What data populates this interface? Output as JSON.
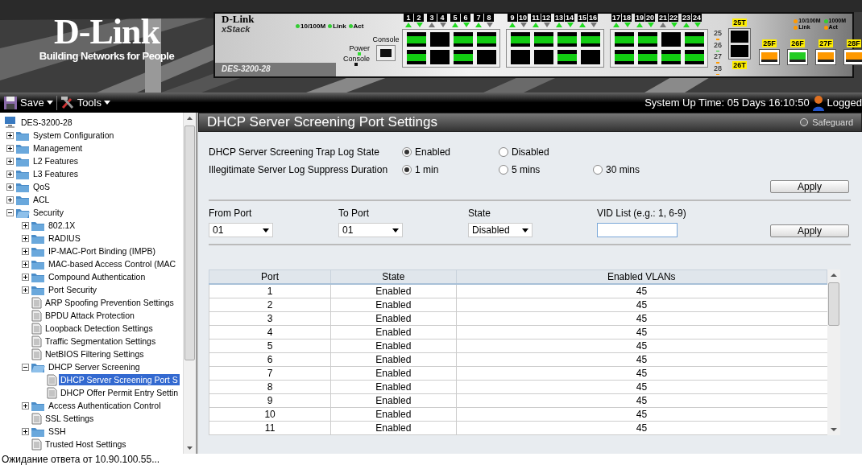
{
  "banner": {
    "logo": "D-Link",
    "tagline": "Building Networks for People",
    "device": {
      "brand": "D-Link",
      "series": "xStack",
      "model": "DES-3200-28",
      "legend": [
        {
          "label": "10/100M",
          "color": "#33cc33"
        },
        {
          "label": "Link",
          "color": "#33cc33"
        },
        {
          "label": "Act",
          "color": "#33cc33"
        }
      ],
      "leds": [
        {
          "label": "Power",
          "color": "#33dd33"
        },
        {
          "label": "Console",
          "color": "#111111"
        }
      ],
      "console_label": "Console",
      "port_groups": [
        {
          "ports": [
            {
              "number": "1",
              "link": true
            },
            {
              "number": "2",
              "link": true
            },
            {
              "number": "3",
              "link": false
            },
            {
              "number": "4",
              "link": false
            },
            {
              "number": "5",
              "link": true
            },
            {
              "number": "6",
              "link": true
            },
            {
              "number": "7",
              "link": true
            },
            {
              "number": "8",
              "link": false
            }
          ]
        },
        {
          "ports": [
            {
              "number": "9",
              "link": true
            },
            {
              "number": "10",
              "link": false
            },
            {
              "number": "11",
              "link": true
            },
            {
              "number": "12",
              "link": false
            },
            {
              "number": "13",
              "link": true
            },
            {
              "number": "14",
              "link": true
            },
            {
              "number": "15",
              "link": true
            },
            {
              "number": "16",
              "link": false
            }
          ]
        },
        {
          "ports": [
            {
              "number": "17",
              "link": true
            },
            {
              "number": "18",
              "link": true
            },
            {
              "number": "19",
              "link": true
            },
            {
              "number": "20",
              "link": true
            },
            {
              "number": "21",
              "link": false
            },
            {
              "number": "22",
              "link": true
            },
            {
              "number": "23",
              "link": true
            },
            {
              "number": "24",
              "link": true
            }
          ]
        }
      ],
      "uplink_leds": [
        {
          "label": "25",
          "color": "#ff9900"
        },
        {
          "label": "26",
          "color": "#22cc22"
        },
        {
          "label": "27",
          "color": "#ff9900"
        },
        {
          "label": "28",
          "color": "#ff9900"
        }
      ],
      "combo": {
        "top": "25T",
        "bottom": "26T"
      },
      "sfp": [
        {
          "label": "25F",
          "color": "#ff9900"
        },
        {
          "label": "26F",
          "color": "#22cc22"
        },
        {
          "label": "27F",
          "color": "#ff9900"
        },
        {
          "label": "28F",
          "color": "#ff9900"
        }
      ],
      "legend_right": [
        {
          "label": "10/100M",
          "color": "#ff9900"
        },
        {
          "label": "1000M",
          "color": "#33cc33"
        },
        {
          "label": "Link",
          "color": "#ff9900"
        },
        {
          "label": "Act",
          "color": "#ff9900"
        }
      ]
    }
  },
  "toolbar": {
    "menus": [
      "Save",
      "Tools"
    ],
    "uptime": "System Up Time: 05 Days 16:10:50",
    "user": "Logged"
  },
  "tree": {
    "label": "DES-3200-28",
    "children": [
      {
        "label": "System Configuration",
        "kind": "folder",
        "expanded": false,
        "selected": false
      },
      {
        "label": "Management",
        "kind": "folder",
        "expanded": false,
        "selected": false
      },
      {
        "label": "L2 Features",
        "kind": "folder",
        "expanded": false,
        "selected": false
      },
      {
        "label": "L3 Features",
        "kind": "folder",
        "expanded": false,
        "selected": false
      },
      {
        "label": "QoS",
        "kind": "folder",
        "expanded": false,
        "selected": false
      },
      {
        "label": "ACL",
        "kind": "folder",
        "expanded": false,
        "selected": false
      },
      {
        "label": "Security",
        "kind": "folder",
        "expanded": true,
        "selected": false,
        "children": [
          {
            "label": "802.1X",
            "kind": "folder",
            "expanded": false,
            "selected": false
          },
          {
            "label": "RADIUS",
            "kind": "folder",
            "expanded": false,
            "selected": false
          },
          {
            "label": "IP-MAC-Port Binding (IMPB)",
            "kind": "folder",
            "expanded": false,
            "selected": false
          },
          {
            "label": "MAC-based Access Control (MAC",
            "kind": "folder",
            "expanded": false,
            "selected": false
          },
          {
            "label": "Compound Authentication",
            "kind": "folder",
            "expanded": false,
            "selected": false
          },
          {
            "label": "Port Security",
            "kind": "folder",
            "expanded": false,
            "selected": false
          },
          {
            "label": "ARP Spoofing Prevention Settings",
            "kind": "page",
            "selected": false
          },
          {
            "label": "BPDU Attack Protection",
            "kind": "page",
            "selected": false
          },
          {
            "label": "Loopback Detection Settings",
            "kind": "page",
            "selected": false
          },
          {
            "label": "Traffic Segmentation Settings",
            "kind": "page",
            "selected": false
          },
          {
            "label": "NetBIOS Filtering Settings",
            "kind": "page",
            "selected": false
          },
          {
            "label": "DHCP Server Screening",
            "kind": "folder",
            "expanded": true,
            "selected": false,
            "children": [
              {
                "label": "DHCP Server Screening Port S",
                "kind": "page",
                "selected": true
              },
              {
                "label": "DHCP Offer Permit Entry Settin",
                "kind": "page",
                "selected": false
              }
            ]
          },
          {
            "label": "Access Authentication Control",
            "kind": "folder",
            "expanded": false,
            "selected": false
          },
          {
            "label": "SSL Settings",
            "kind": "page",
            "selected": false
          },
          {
            "label": "SSH",
            "kind": "folder",
            "expanded": false,
            "selected": false
          },
          {
            "label": "Trusted Host Settings",
            "kind": "page",
            "selected": false
          }
        ]
      }
    ]
  },
  "page": {
    "title": "DHCP Server Screening Port Settings",
    "safeguard": "Safeguard",
    "settings": [
      {
        "label": "DHCP Server Screening Trap Log State",
        "options": [
          {
            "label": "Enabled",
            "selected": true
          },
          {
            "label": "Disabled",
            "selected": false
          }
        ]
      },
      {
        "label": "Illegitimate Server Log Suppress Duration",
        "options": [
          {
            "label": "1 min",
            "selected": true
          },
          {
            "label": "5 mins",
            "selected": false
          },
          {
            "label": "30 mins",
            "selected": false
          }
        ]
      }
    ],
    "apply_top": "Apply",
    "filters": [
      {
        "label": "From Port",
        "kind": "select",
        "value": "01"
      },
      {
        "label": "To Port",
        "kind": "select",
        "value": "01"
      },
      {
        "label": "State",
        "kind": "select",
        "value": "Disabled"
      },
      {
        "label": "VID List (e.g.: 1, 6-9)",
        "kind": "text"
      }
    ],
    "apply_filters": "Apply",
    "table": {
      "columns": [
        "Port",
        "State",
        "Enabled VLANs"
      ],
      "rows": [
        [
          "1",
          "Enabled",
          "45"
        ],
        [
          "2",
          "Enabled",
          "45"
        ],
        [
          "3",
          "Enabled",
          "45"
        ],
        [
          "4",
          "Enabled",
          "45"
        ],
        [
          "5",
          "Enabled",
          "45"
        ],
        [
          "6",
          "Enabled",
          "45"
        ],
        [
          "7",
          "Enabled",
          "45"
        ],
        [
          "8",
          "Enabled",
          "45"
        ],
        [
          "9",
          "Enabled",
          "45"
        ],
        [
          "10",
          "Enabled",
          "45"
        ],
        [
          "11",
          "Enabled",
          "45"
        ]
      ]
    }
  },
  "status_bar": "Ожидание ответа от 10.90.100.55..."
}
